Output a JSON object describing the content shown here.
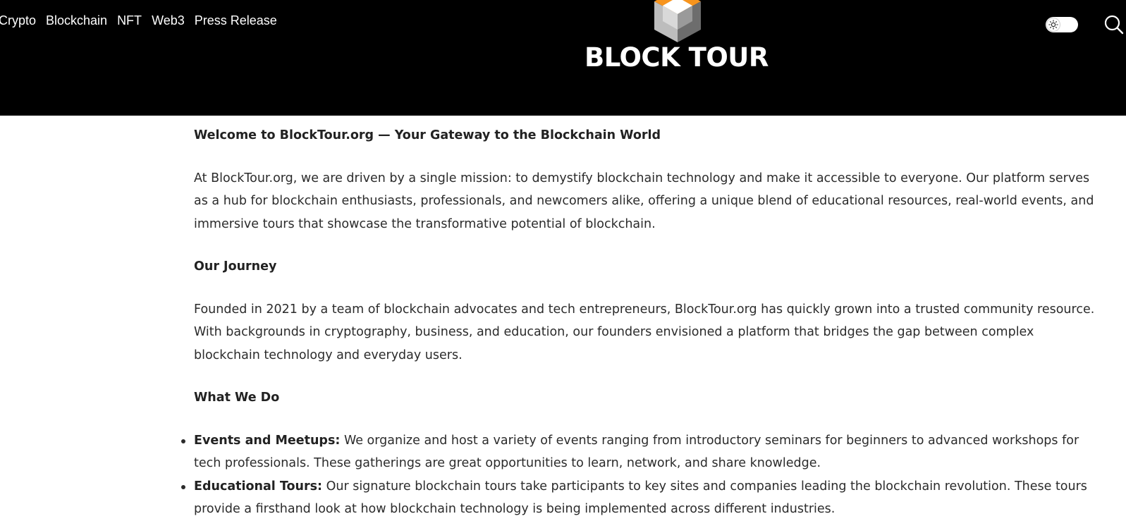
{
  "nav": {
    "items": [
      {
        "label": "Crypto"
      },
      {
        "label": "Blockchain"
      },
      {
        "label": "NFT"
      },
      {
        "label": "Web3"
      },
      {
        "label": "Press Release"
      }
    ]
  },
  "brand": {
    "logo_text": "BLOCK TOUR",
    "cube_top_color": "#f7941d",
    "cube_left_color": "#bdbdbd",
    "cube_right_color": "#6d6d6d"
  },
  "header": {
    "background": "#000000",
    "toggle_icon": "sun-icon",
    "search_icon": "search-icon"
  },
  "article": {
    "welcome_heading": "Welcome to BlockTour.org — Your Gateway to the Blockchain World",
    "intro": "At BlockTour.org, we are driven by a single mission: to demystify blockchain technology and make it accessible to everyone. Our platform serves as a hub for blockchain enthusiasts, professionals, and newcomers alike, offering a unique blend of educational resources, real-world events, and immersive tours that showcase the transformative potential of blockchain.",
    "journey_heading": "Our Journey",
    "journey_text": "Founded in 2021 by a team of blockchain advocates and tech entrepreneurs, BlockTour.org has quickly grown into a trusted community resource. With backgrounds in cryptography, business, and education, our founders envisioned a platform that bridges the gap between complex blockchain technology and everyday users.",
    "what_heading": "What We Do",
    "services": [
      {
        "title": "Events and Meetups:",
        "text": " We organize and host a variety of events ranging from introductory seminars for beginners to advanced workshops for tech professionals. These gatherings are great opportunities to learn, network, and share knowledge."
      },
      {
        "title": "Educational Tours:",
        "text": " Our signature blockchain tours take participants to key sites and companies leading the blockchain revolution. These tours provide a firsthand look at how blockchain technology is being implemented across different industries."
      }
    ]
  }
}
